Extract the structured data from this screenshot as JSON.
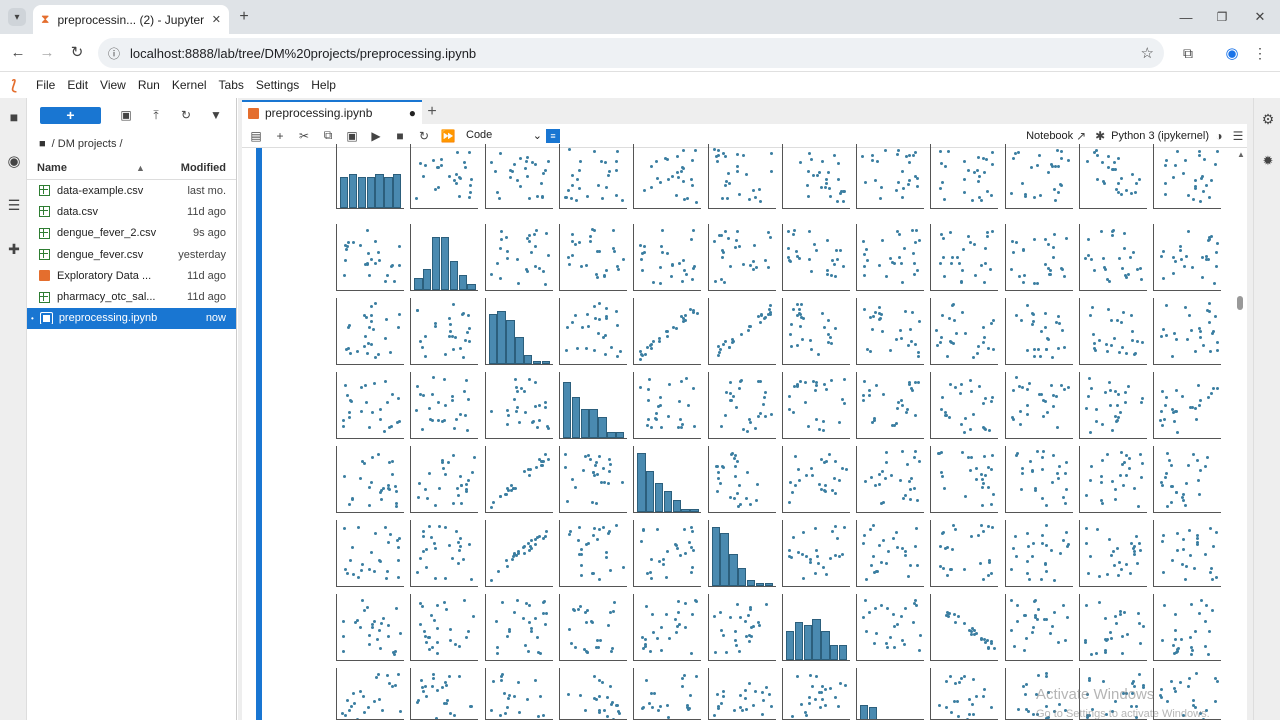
{
  "browser": {
    "tab_title": "preprocessin... (2) - JupyterLab",
    "url": "localhost:8888/lab/tree/DM%20projects/preprocessing.ipynb"
  },
  "menu": [
    "File",
    "Edit",
    "View",
    "Run",
    "Kernel",
    "Tabs",
    "Settings",
    "Help"
  ],
  "filebrowser": {
    "breadcrumb": "/ DM projects /",
    "col_name": "Name",
    "col_modified": "Modified",
    "files": [
      {
        "name": "data-example.csv",
        "modified": "last mo.",
        "type": "csv"
      },
      {
        "name": "data.csv",
        "modified": "11d ago",
        "type": "csv"
      },
      {
        "name": "dengue_fever_2.csv",
        "modified": "9s ago",
        "type": "csv"
      },
      {
        "name": "dengue_fever.csv",
        "modified": "yesterday",
        "type": "csv"
      },
      {
        "name": "Exploratory Data ...",
        "modified": "11d ago",
        "type": "notebook"
      },
      {
        "name": "pharmacy_otc_sal...",
        "modified": "11d ago",
        "type": "csv"
      },
      {
        "name": "preprocessing.ipynb",
        "modified": "now",
        "type": "notebook",
        "selected": true
      }
    ]
  },
  "notebook": {
    "tab_label": "preprocessing.ipynb",
    "cell_type": "Code",
    "notebook_label": "Notebook",
    "kernel": "Python 3 (ipykernel)"
  },
  "watermark": {
    "line1": "Activate Windows",
    "line2": "Go to Settings to activate Windows."
  },
  "colors": {
    "accent": "#1976d2",
    "marker": "#3b7ea1",
    "hist": "#4a8ab0"
  }
}
